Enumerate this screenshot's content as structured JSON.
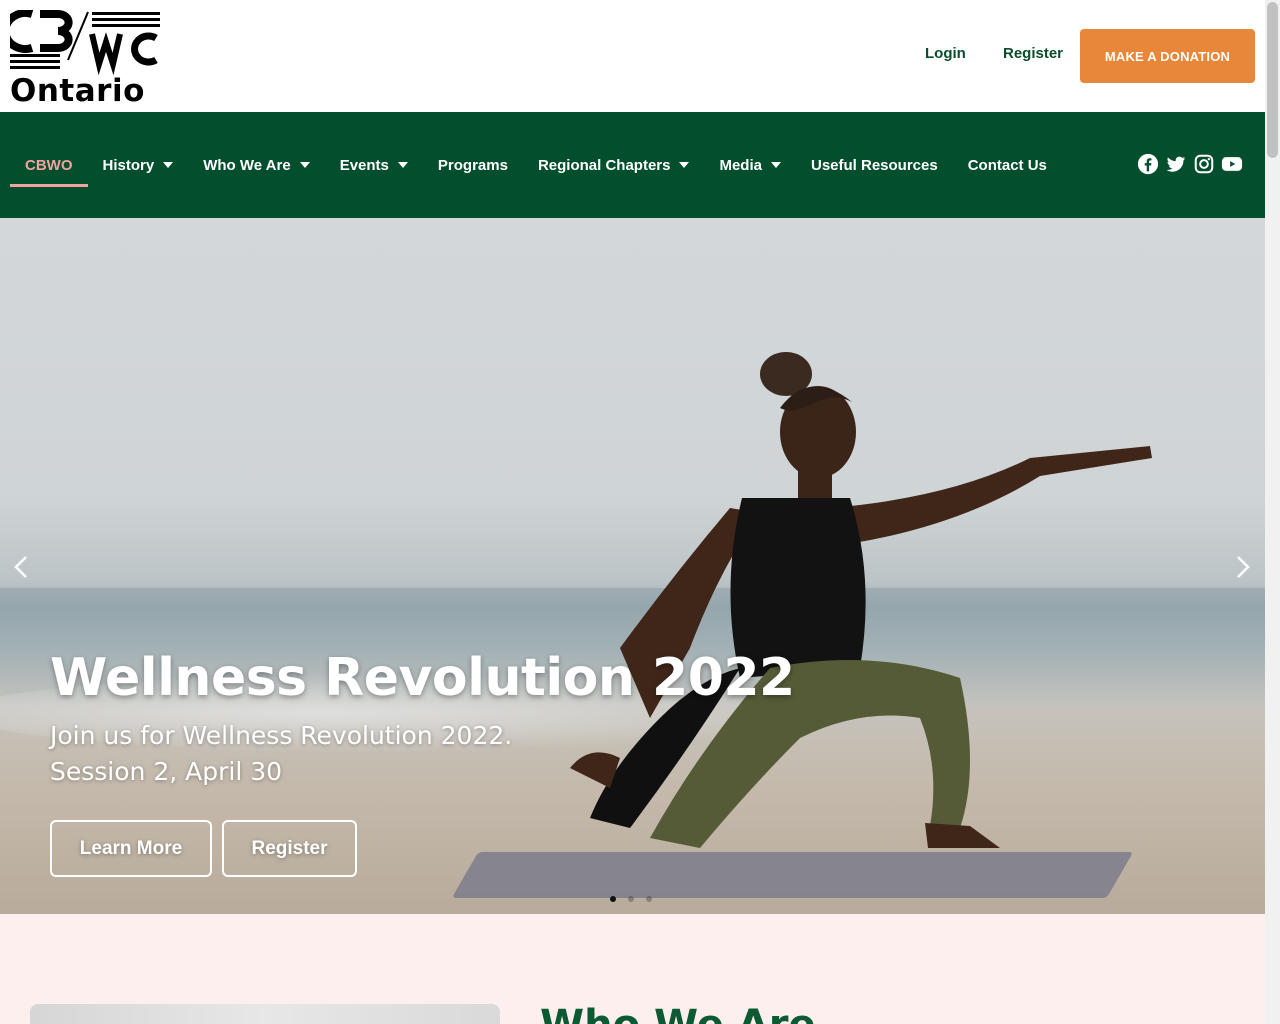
{
  "header": {
    "logo": {
      "line1": "CB/WC",
      "line2": "Ontario",
      "alt": "CBWC Ontario logo"
    },
    "login_label": "Login",
    "register_label": "Register",
    "donate_label": "MAKE A DONATION"
  },
  "nav": {
    "items": [
      {
        "label": "CBWO",
        "dropdown": false,
        "active": true
      },
      {
        "label": "History",
        "dropdown": true
      },
      {
        "label": "Who We Are",
        "dropdown": true
      },
      {
        "label": "Events",
        "dropdown": true
      },
      {
        "label": "Programs",
        "dropdown": false
      },
      {
        "label": "Regional Chapters",
        "dropdown": true
      },
      {
        "label": "Media",
        "dropdown": true
      },
      {
        "label": "Useful Resources",
        "dropdown": false
      },
      {
        "label": "Contact Us",
        "dropdown": false
      }
    ],
    "social_icons": [
      "facebook-icon",
      "twitter-icon",
      "instagram-icon",
      "youtube-icon"
    ]
  },
  "hero": {
    "title": "Wellness Revolution 2022",
    "description_line1": "Join us for Wellness Revolution 2022.",
    "description_line2": "Session 2, April 30",
    "learn_more_label": "Learn More",
    "register_label": "Register",
    "slide_count": 3,
    "active_slide": 1
  },
  "about": {
    "title": "Who We Are"
  },
  "colors": {
    "brand_green": "#034f2d",
    "accent_orange": "#e8873a",
    "active_pink": "#f2a2a0",
    "section_bg": "#fcefee"
  }
}
